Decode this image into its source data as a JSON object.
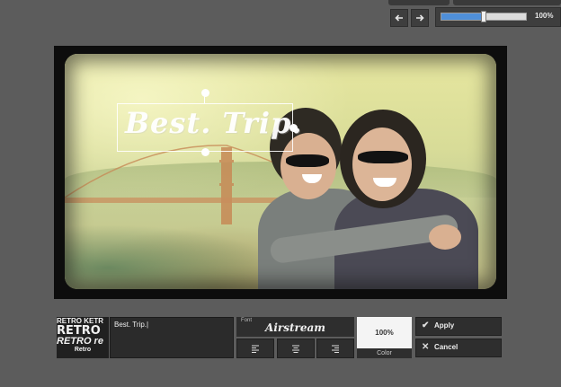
{
  "toolbar": {
    "zoom_label": "100%",
    "zoom_value_percent": 100,
    "slider_fill_fraction": 0.5
  },
  "canvas": {
    "overlay_text": "Best. Trip."
  },
  "text_panel": {
    "font_preview": [
      "RETRO KETR",
      "RETRO",
      "RETRO re",
      "Retro"
    ],
    "text_value": "Best. Trip.",
    "font_label": "Font",
    "font_name": "Airstream",
    "color_value": "100%",
    "color_label": "Color",
    "apply_label": "Apply",
    "cancel_label": "Cancel"
  },
  "icons": {
    "back": "arrow-left-icon",
    "forward": "arrow-right-icon",
    "apply": "checkmark-icon",
    "cancel": "x-icon",
    "align_left": "align-left-icon",
    "align_center": "align-center-icon",
    "align_right": "align-right-icon"
  }
}
